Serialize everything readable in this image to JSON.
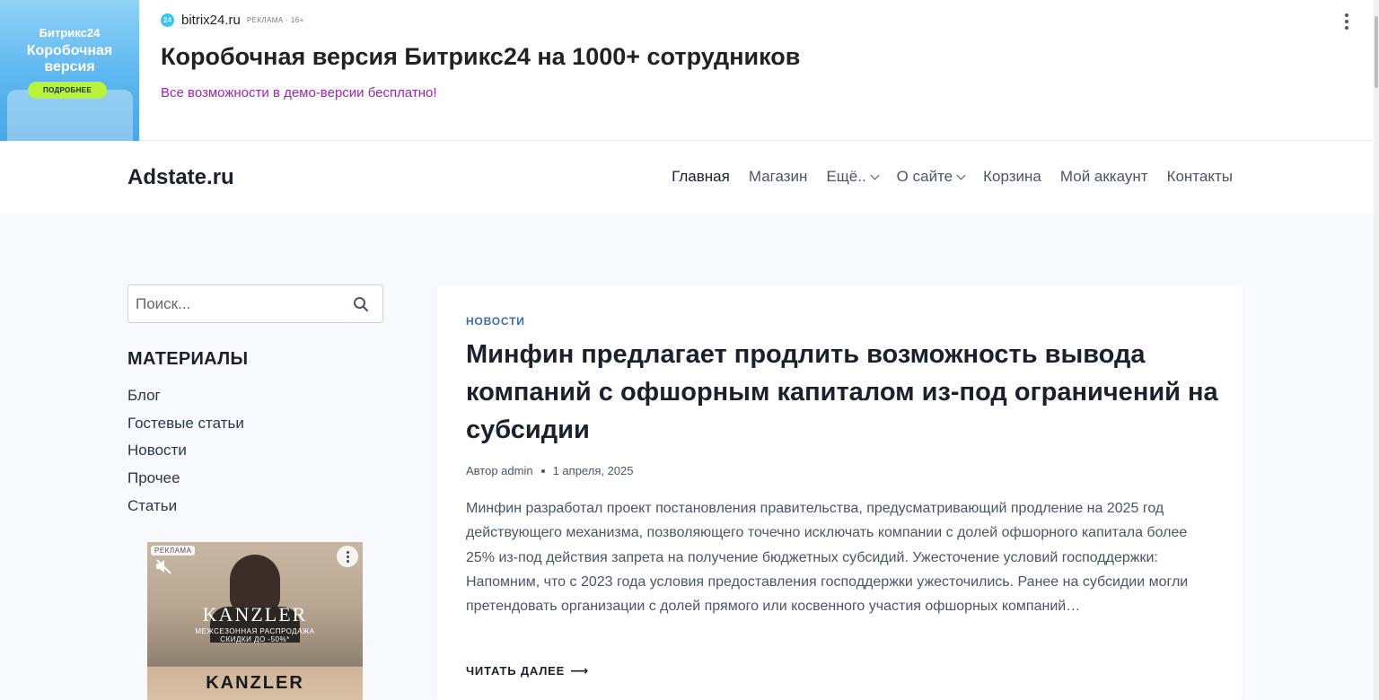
{
  "top_ad": {
    "thumb_brand": "Битрикс24",
    "thumb_headline": "Коробочная версия",
    "thumb_button": "ПОДРОБНЕЕ",
    "domain": "bitrix24.ru",
    "ad_mark": "РЕКЛАМА · 16+",
    "title": "Коробочная версия Битрикс24 на 1000+ сотрудников",
    "subtitle": "Все возможности в демо-версии бесплатно!",
    "logo_text": "24"
  },
  "header": {
    "site_name": "Adstate.ru",
    "nav": [
      {
        "label": "Главная"
      },
      {
        "label": "Магазин"
      },
      {
        "label": "Ещё.."
      },
      {
        "label": "О сайте"
      },
      {
        "label": "Корзина"
      },
      {
        "label": "Мой аккаунт"
      },
      {
        "label": "Контакты"
      }
    ]
  },
  "sidebar": {
    "search_placeholder": "Поиск...",
    "widget_title": "МАТЕРИАЛЫ",
    "categories": [
      "Блог",
      "Гостевые статьи",
      "Новости",
      "Прочее",
      "Статьи"
    ],
    "ad": {
      "tag": "РЕКЛАМА",
      "brand": "KANZLER",
      "promo_line1": "МЕЖСЕЗОННАЯ РАСПРОДАЖА",
      "promo_line2": "СКИДКИ ДО -50%*",
      "brand_bottom": "KANZLER"
    }
  },
  "article": {
    "category": "НОВОСТИ",
    "title": "Минфин предлагает продлить возможность вывода компаний с офшорным капиталом из-под ограничений на субсидии",
    "author": "Автор admin",
    "date": "1 апреля, 2025",
    "excerpt": "Минфин разработал проект постановления правительства, предусматривающий продление на 2025 год действующего механизма, позволяющего точечно исключать компании с долей офшорного капитала более 25% из-под действия запрета на получение бюджетных субсидий. Ужесточение условий господдержки: Напомним, что с 2023 года условия предоставления господдержки ужесточились. Ранее на субсидии могли претендовать организации с долей прямого или косвенного участия офшорных компаний…",
    "read_more": "ЧИТАТЬ ДАЛЕЕ",
    "read_more_arrow": "⟶"
  },
  "colors": {
    "accent": "#3a6ea5",
    "ad_subtitle": "#9c27b0",
    "background": "#f7f9fc"
  }
}
